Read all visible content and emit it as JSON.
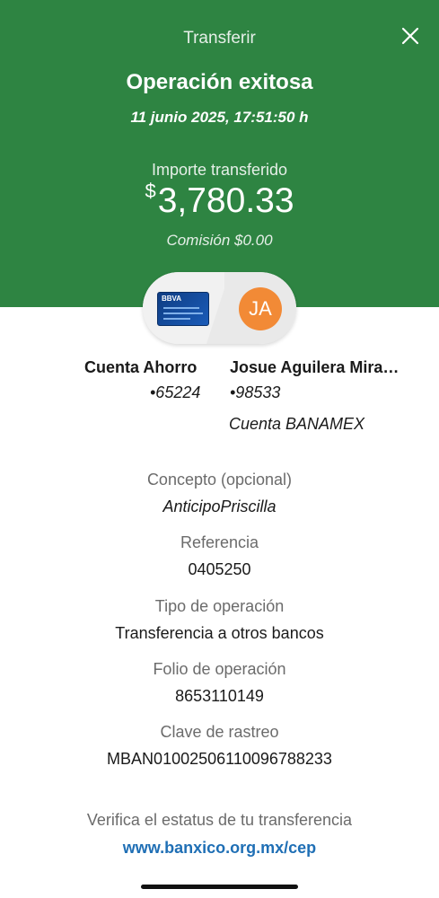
{
  "header": {
    "title": "Transferir",
    "status": "Operación exitosa",
    "datetime": "11 junio 2025, 17:51:50 h",
    "amount_label": "Importe transferido",
    "currency_symbol": "$",
    "amount": "3,780.33",
    "fee": "Comisión  $0.00",
    "close_icon": "close-icon",
    "background_color": "#2e8442"
  },
  "origin": {
    "card_brand": "BBVA",
    "account_name": "Cuenta Ahorro",
    "account_number": "•65224"
  },
  "destination": {
    "initials": "JA",
    "name": "Josue Aguilera Mira…",
    "account_number": "•98533",
    "bank": "Cuenta BANAMEX",
    "avatar_color": "#f28a36"
  },
  "details": [
    {
      "label": "Concepto (opcional)",
      "value": "AnticipoPriscilla"
    },
    {
      "label": "Referencia",
      "value": "0405250"
    },
    {
      "label": "Tipo de operación",
      "value": "Transferencia a otros bancos"
    },
    {
      "label": "Folio de operación",
      "value": "8653110149"
    },
    {
      "label": "Clave de rastreo",
      "value": "MBAN01002506110096788233"
    }
  ],
  "footer": {
    "verify_text": "Verifica el estatus de tu transferencia",
    "link_text": "www.banxico.org.mx/cep",
    "link_color": "#1f6fb5"
  }
}
